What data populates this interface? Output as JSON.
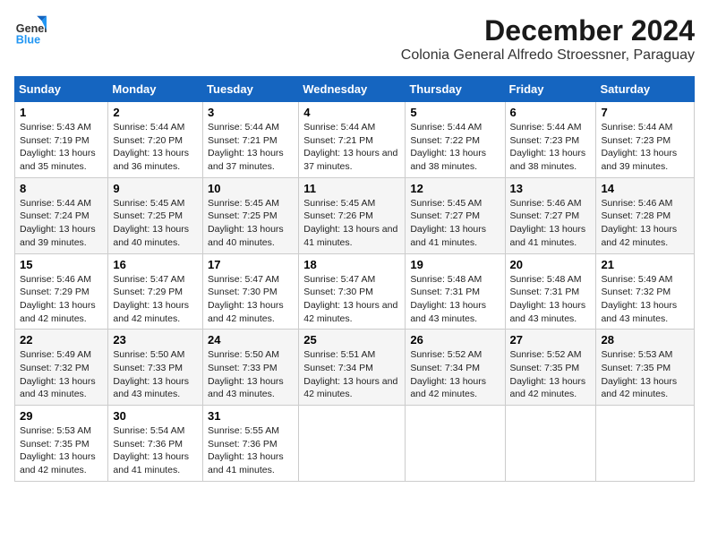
{
  "logo": {
    "text_general": "General",
    "text_blue": "Blue"
  },
  "title": "December 2024",
  "location": "Colonia General Alfredo Stroessner, Paraguay",
  "headers": [
    "Sunday",
    "Monday",
    "Tuesday",
    "Wednesday",
    "Thursday",
    "Friday",
    "Saturday"
  ],
  "weeks": [
    [
      {
        "day": "1",
        "sunrise": "Sunrise: 5:43 AM",
        "sunset": "Sunset: 7:19 PM",
        "daylight": "Daylight: 13 hours and 35 minutes."
      },
      {
        "day": "2",
        "sunrise": "Sunrise: 5:44 AM",
        "sunset": "Sunset: 7:20 PM",
        "daylight": "Daylight: 13 hours and 36 minutes."
      },
      {
        "day": "3",
        "sunrise": "Sunrise: 5:44 AM",
        "sunset": "Sunset: 7:21 PM",
        "daylight": "Daylight: 13 hours and 37 minutes."
      },
      {
        "day": "4",
        "sunrise": "Sunrise: 5:44 AM",
        "sunset": "Sunset: 7:21 PM",
        "daylight": "Daylight: 13 hours and 37 minutes."
      },
      {
        "day": "5",
        "sunrise": "Sunrise: 5:44 AM",
        "sunset": "Sunset: 7:22 PM",
        "daylight": "Daylight: 13 hours and 38 minutes."
      },
      {
        "day": "6",
        "sunrise": "Sunrise: 5:44 AM",
        "sunset": "Sunset: 7:23 PM",
        "daylight": "Daylight: 13 hours and 38 minutes."
      },
      {
        "day": "7",
        "sunrise": "Sunrise: 5:44 AM",
        "sunset": "Sunset: 7:23 PM",
        "daylight": "Daylight: 13 hours and 39 minutes."
      }
    ],
    [
      {
        "day": "8",
        "sunrise": "Sunrise: 5:44 AM",
        "sunset": "Sunset: 7:24 PM",
        "daylight": "Daylight: 13 hours and 39 minutes."
      },
      {
        "day": "9",
        "sunrise": "Sunrise: 5:45 AM",
        "sunset": "Sunset: 7:25 PM",
        "daylight": "Daylight: 13 hours and 40 minutes."
      },
      {
        "day": "10",
        "sunrise": "Sunrise: 5:45 AM",
        "sunset": "Sunset: 7:25 PM",
        "daylight": "Daylight: 13 hours and 40 minutes."
      },
      {
        "day": "11",
        "sunrise": "Sunrise: 5:45 AM",
        "sunset": "Sunset: 7:26 PM",
        "daylight": "Daylight: 13 hours and 41 minutes."
      },
      {
        "day": "12",
        "sunrise": "Sunrise: 5:45 AM",
        "sunset": "Sunset: 7:27 PM",
        "daylight": "Daylight: 13 hours and 41 minutes."
      },
      {
        "day": "13",
        "sunrise": "Sunrise: 5:46 AM",
        "sunset": "Sunset: 7:27 PM",
        "daylight": "Daylight: 13 hours and 41 minutes."
      },
      {
        "day": "14",
        "sunrise": "Sunrise: 5:46 AM",
        "sunset": "Sunset: 7:28 PM",
        "daylight": "Daylight: 13 hours and 42 minutes."
      }
    ],
    [
      {
        "day": "15",
        "sunrise": "Sunrise: 5:46 AM",
        "sunset": "Sunset: 7:29 PM",
        "daylight": "Daylight: 13 hours and 42 minutes."
      },
      {
        "day": "16",
        "sunrise": "Sunrise: 5:47 AM",
        "sunset": "Sunset: 7:29 PM",
        "daylight": "Daylight: 13 hours and 42 minutes."
      },
      {
        "day": "17",
        "sunrise": "Sunrise: 5:47 AM",
        "sunset": "Sunset: 7:30 PM",
        "daylight": "Daylight: 13 hours and 42 minutes."
      },
      {
        "day": "18",
        "sunrise": "Sunrise: 5:47 AM",
        "sunset": "Sunset: 7:30 PM",
        "daylight": "Daylight: 13 hours and 42 minutes."
      },
      {
        "day": "19",
        "sunrise": "Sunrise: 5:48 AM",
        "sunset": "Sunset: 7:31 PM",
        "daylight": "Daylight: 13 hours and 43 minutes."
      },
      {
        "day": "20",
        "sunrise": "Sunrise: 5:48 AM",
        "sunset": "Sunset: 7:31 PM",
        "daylight": "Daylight: 13 hours and 43 minutes."
      },
      {
        "day": "21",
        "sunrise": "Sunrise: 5:49 AM",
        "sunset": "Sunset: 7:32 PM",
        "daylight": "Daylight: 13 hours and 43 minutes."
      }
    ],
    [
      {
        "day": "22",
        "sunrise": "Sunrise: 5:49 AM",
        "sunset": "Sunset: 7:32 PM",
        "daylight": "Daylight: 13 hours and 43 minutes."
      },
      {
        "day": "23",
        "sunrise": "Sunrise: 5:50 AM",
        "sunset": "Sunset: 7:33 PM",
        "daylight": "Daylight: 13 hours and 43 minutes."
      },
      {
        "day": "24",
        "sunrise": "Sunrise: 5:50 AM",
        "sunset": "Sunset: 7:33 PM",
        "daylight": "Daylight: 13 hours and 43 minutes."
      },
      {
        "day": "25",
        "sunrise": "Sunrise: 5:51 AM",
        "sunset": "Sunset: 7:34 PM",
        "daylight": "Daylight: 13 hours and 42 minutes."
      },
      {
        "day": "26",
        "sunrise": "Sunrise: 5:52 AM",
        "sunset": "Sunset: 7:34 PM",
        "daylight": "Daylight: 13 hours and 42 minutes."
      },
      {
        "day": "27",
        "sunrise": "Sunrise: 5:52 AM",
        "sunset": "Sunset: 7:35 PM",
        "daylight": "Daylight: 13 hours and 42 minutes."
      },
      {
        "day": "28",
        "sunrise": "Sunrise: 5:53 AM",
        "sunset": "Sunset: 7:35 PM",
        "daylight": "Daylight: 13 hours and 42 minutes."
      }
    ],
    [
      {
        "day": "29",
        "sunrise": "Sunrise: 5:53 AM",
        "sunset": "Sunset: 7:35 PM",
        "daylight": "Daylight: 13 hours and 42 minutes."
      },
      {
        "day": "30",
        "sunrise": "Sunrise: 5:54 AM",
        "sunset": "Sunset: 7:36 PM",
        "daylight": "Daylight: 13 hours and 41 minutes."
      },
      {
        "day": "31",
        "sunrise": "Sunrise: 5:55 AM",
        "sunset": "Sunset: 7:36 PM",
        "daylight": "Daylight: 13 hours and 41 minutes."
      },
      null,
      null,
      null,
      null
    ]
  ]
}
